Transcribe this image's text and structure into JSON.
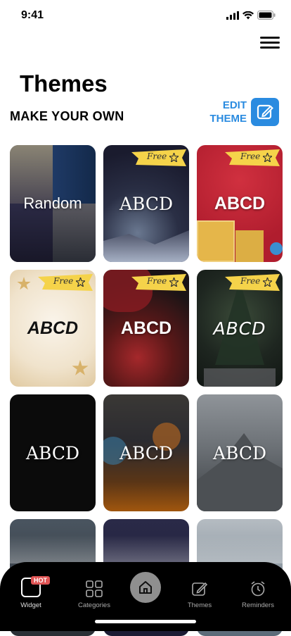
{
  "status": {
    "time": "9:41"
  },
  "header": {
    "title": "Themes",
    "subtitle": "MAKE YOUR OWN",
    "edit_line1": "EDIT",
    "edit_line2": "THEME",
    "accent": "#2a8be0"
  },
  "themes": [
    {
      "label": "Random",
      "free": false,
      "style": "sans"
    },
    {
      "label": "ABCD",
      "free": true,
      "style": "serif"
    },
    {
      "label": "ABCD",
      "free": true,
      "style": "bold"
    },
    {
      "label": "ABCD",
      "free": true,
      "style": "italic"
    },
    {
      "label": "ABCD",
      "free": true,
      "style": "bold"
    },
    {
      "label": "ABCD",
      "free": true,
      "style": "hand"
    },
    {
      "label": "ABCD",
      "free": false,
      "style": "serif"
    },
    {
      "label": "ABCD",
      "free": false,
      "style": "serif"
    },
    {
      "label": "ABCD",
      "free": false,
      "style": "serif"
    }
  ],
  "free_badge": "Free",
  "tabbar": {
    "widget": "Widget",
    "hot_badge": "HOT",
    "categories": "Categories",
    "themes": "Themes",
    "reminders": "Reminders"
  },
  "icons": [
    "menu-icon",
    "pencil-square-icon",
    "star-icon",
    "widget-icon",
    "grid-icon",
    "home-icon",
    "edit-icon",
    "alarm-clock-icon"
  ]
}
